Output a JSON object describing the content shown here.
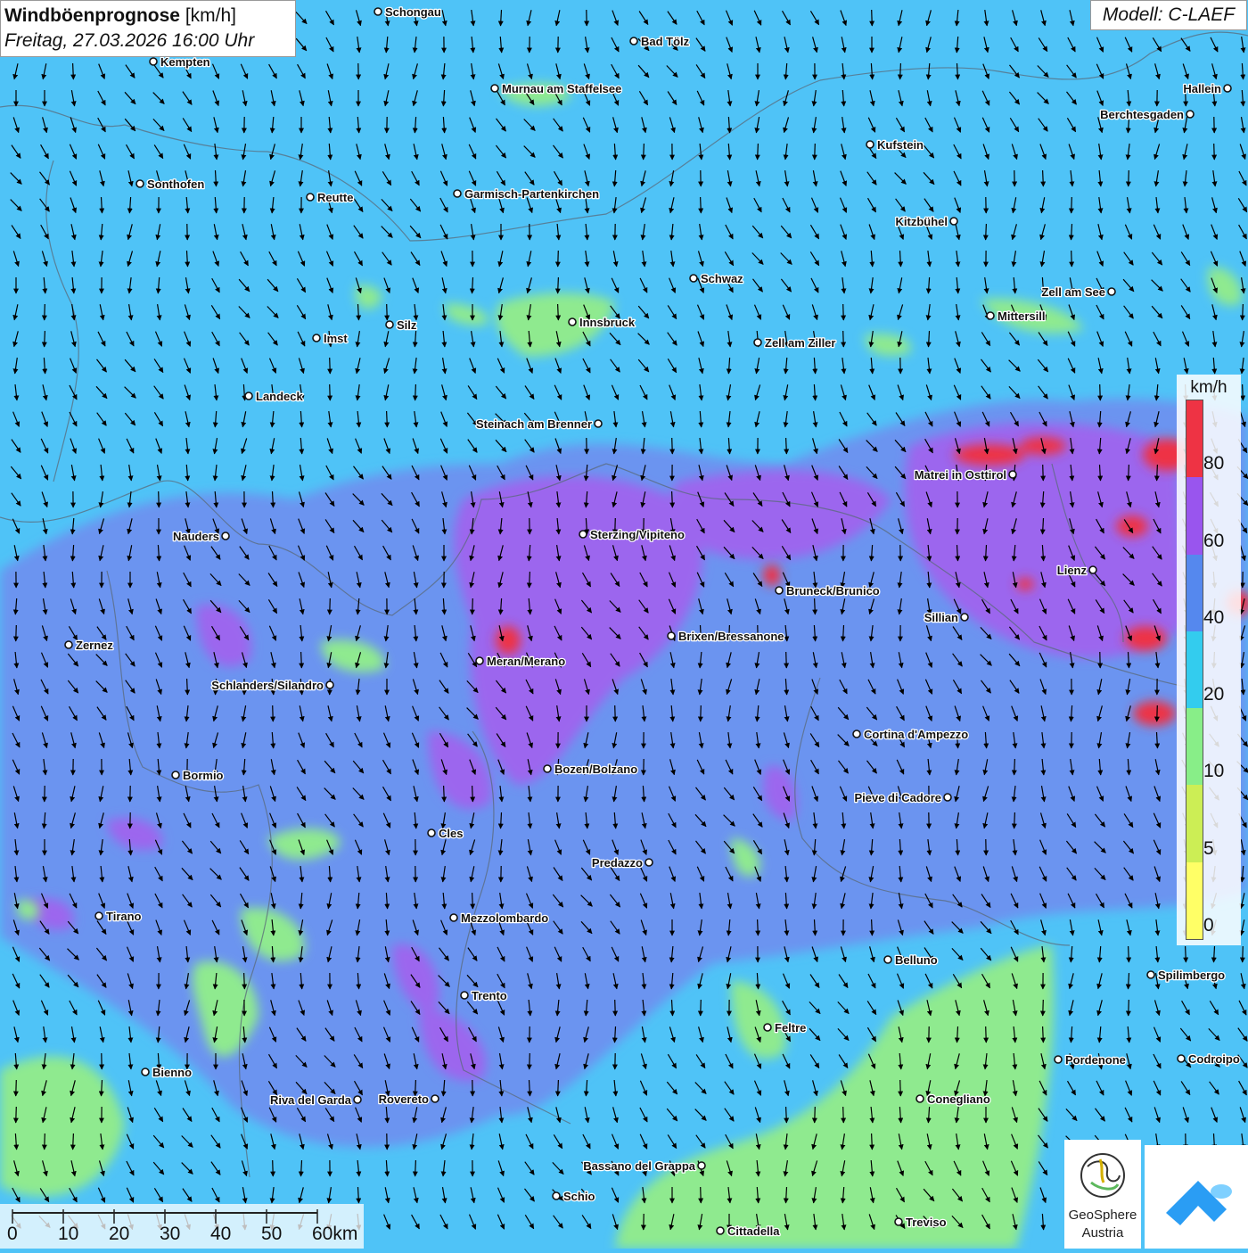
{
  "header": {
    "title_bold": "Windböenprognose",
    "title_unit": "[km/h]",
    "datetime": "Freitag, 27.03.2026 16:00 Uhr"
  },
  "model_label": "Modell: C-LAEF",
  "legend": {
    "unit": "km/h",
    "ticks": [
      "0",
      "5",
      "10",
      "20",
      "40",
      "60",
      "80"
    ],
    "colors": [
      "#ffff66",
      "#ccee55",
      "#88ee88",
      "#33ccee",
      "#5588ee",
      "#9955ee",
      "#ee3344"
    ]
  },
  "scale_bar": {
    "labels": [
      "0",
      "10",
      "20",
      "30",
      "40",
      "50",
      "60km"
    ]
  },
  "logos": {
    "geosphere_line1": "GeoSphere",
    "geosphere_line2": "Austria"
  },
  "cities": [
    "Schongau",
    "Kempten",
    "Bad Tölz",
    "Murnau am Staffelsee",
    "Hallein",
    "Berchtesgaden",
    "Kufstein",
    "Sonthofen",
    "Reutte",
    "Garmisch-Partenkirchen",
    "Kitzbühel",
    "Schwaz",
    "Zell am See",
    "Silz",
    "Innsbruck",
    "Mittersill",
    "Imst",
    "Zell am Ziller",
    "Landeck",
    "Steinach am Brenner",
    "Matrei in Osttirol",
    "Nauders",
    "Sterzing/Vipiteno",
    "Lienz",
    "Bruneck/Brunico",
    "Sillian",
    "Zernez",
    "Brixen/Bressanone",
    "Meran/Merano",
    "Schlanders/Silandro",
    "Cortina d'Ampezzo",
    "Bozen/Bolzano",
    "Bormio",
    "Pieve di Cadore",
    "Cles",
    "Predazzo",
    "Tirano",
    "Mezzolombardo",
    "Belluno",
    "Spilimbergo",
    "Trento",
    "Feltre",
    "Pordenone",
    "Codroipo",
    "Bienno",
    "Riva del Garda",
    "Rovereto",
    "Conegliano",
    "Bassano del Grappa",
    "Schio",
    "Treviso",
    "Cittadella"
  ]
}
